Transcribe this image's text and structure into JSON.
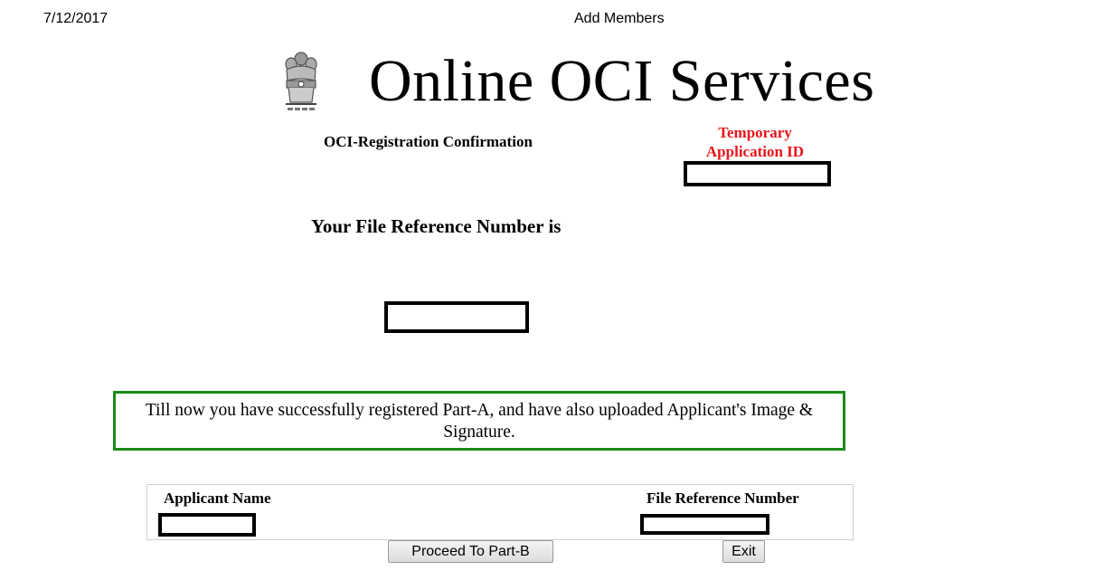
{
  "print_header": {
    "date": "7/12/2017",
    "page_title": "Add Members"
  },
  "banner": {
    "title": "Online OCI Services",
    "emblem_icon": "national-emblem-icon"
  },
  "confirmation": {
    "heading": "OCI-Registration Confirmation",
    "temp_id_label": "Temporary Application ID",
    "temp_id_label_color": "#e8141b",
    "temp_id_value": "",
    "file_ref_heading": "Your File Reference Number is",
    "file_ref_value": ""
  },
  "success_message": {
    "text": "Till now you have successfully registered Part-A, and have also uploaded Applicant's Image & Signature.",
    "border_color": "#1a8a1a"
  },
  "applicant_table": {
    "headers": [
      "Applicant Name",
      "File Reference Number"
    ],
    "rows": [
      {
        "applicant_name": "",
        "file_reference_number": ""
      }
    ]
  },
  "actions": {
    "proceed_label": "Proceed To Part-B",
    "exit_label": "Exit"
  }
}
